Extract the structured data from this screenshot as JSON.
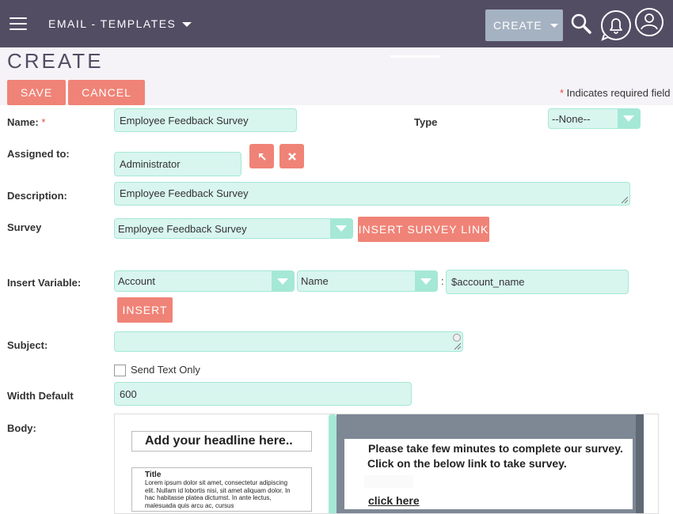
{
  "topbar": {
    "module_title": "EMAIL - TEMPLATES",
    "create_label": "CREATE"
  },
  "page": {
    "title": "CREATE",
    "save_label": "SAVE",
    "cancel_label": "CANCEL",
    "required_star": "*",
    "required_note": " Indicates required field"
  },
  "form": {
    "name_label": "Name:",
    "name_required": "*",
    "name_value": "Employee Feedback Survey",
    "type_label": "Type",
    "type_value": "--None--",
    "assigned_label": "Assigned to:",
    "assigned_value": "Administrator",
    "description_label": "Description:",
    "description_value": "Employee Feedback Survey",
    "survey_label": "Survey",
    "survey_value": "Employee Feedback Survey",
    "insert_survey_link_label": "INSERT SURVEY LINK",
    "insert_variable_label": "Insert Variable:",
    "variable_module": "Account",
    "variable_field": "Name",
    "variable_separator": ":",
    "variable_value": "$account_name",
    "insert_label": "INSERT",
    "subject_label": "Subject:",
    "subject_value": "",
    "send_text_only_label": "Send Text Only",
    "width_default_label": "Width Default",
    "width_default_value": "600",
    "body_label": "Body:"
  },
  "editor": {
    "headline_template": "Add your headline here..",
    "block_title": "Title",
    "block_text": "Lorem ipsum dolor sit amet, consectetur adipiscing elit. Nullam id lobortis nisi, sit amet aliquam dolor. In hac habitasse platea dictumst. In ante lectus, malesuada quis arcu ac, cursus",
    "email_line1": "Please take few minutes to complete our survey.",
    "email_line2": "Click on the below link to take survey.",
    "email_link": "click here"
  },
  "colors": {
    "topbar": "#534d64",
    "accent": "#f08377",
    "input_bg": "#d8f5ee",
    "input_border": "#a5e8d6",
    "create_button": "#a5b2c1"
  }
}
